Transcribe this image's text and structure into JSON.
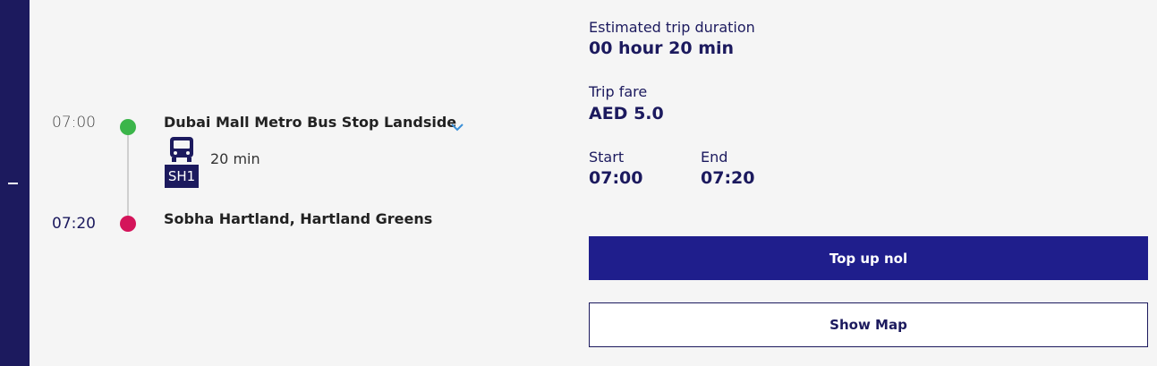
{
  "journey": {
    "departure_time": "07:00",
    "arrival_time": "07:20",
    "origin": "Dubai Mall Metro Bus Stop Landside",
    "destination": "Sobha Hartland, Hartland Greens",
    "leg": {
      "mode_icon": "bus-icon",
      "route": "SH1",
      "duration": "20 min"
    },
    "colors": {
      "origin_dot": "#3bb54a",
      "destination_dot": "#d4145a"
    }
  },
  "summary": {
    "duration_label": "Estimated trip duration",
    "duration_value": "00 hour 20 min",
    "fare_label": "Trip fare",
    "fare_value": "AED 5.0",
    "start_label": "Start",
    "start_value": "07:00",
    "end_label": "End",
    "end_value": "07:20"
  },
  "actions": {
    "top_up_label": "Top up nol",
    "show_map_label": "Show Map"
  },
  "theme": {
    "brand": "#1c1a5e",
    "primary_button": "#1f1e8c"
  }
}
